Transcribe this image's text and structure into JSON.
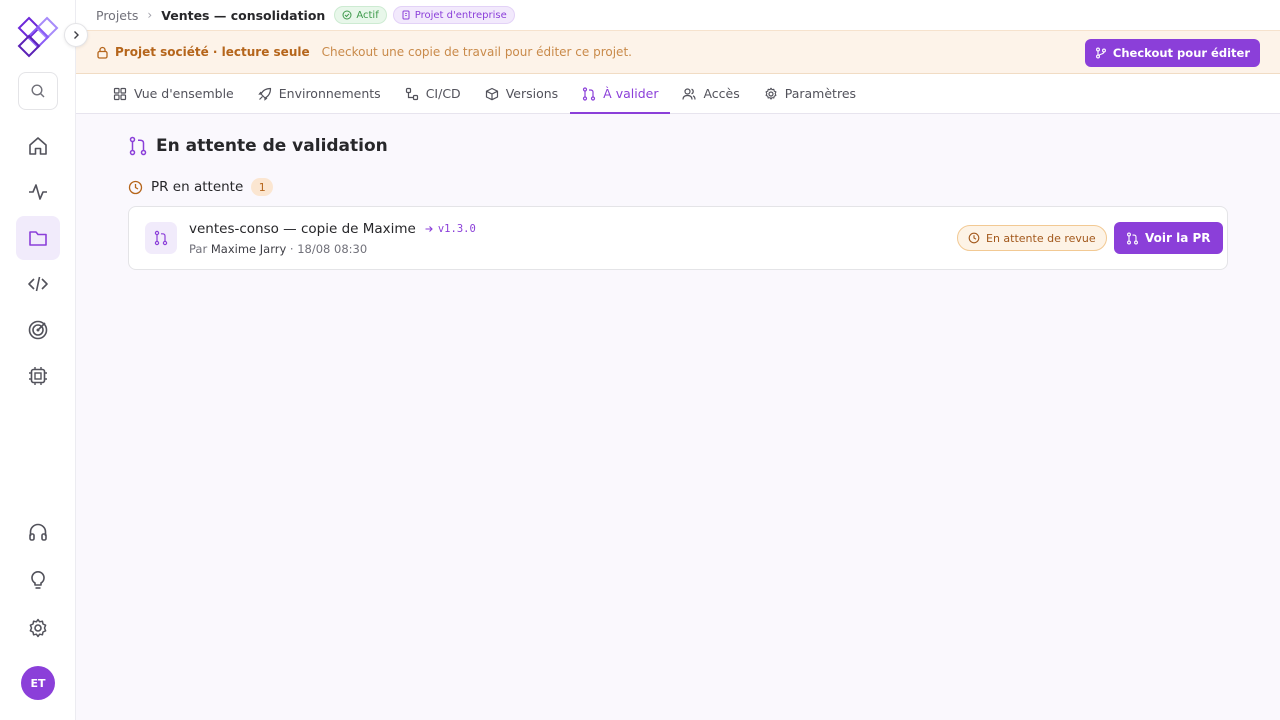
{
  "colors": {
    "accent": "#8b3fd9",
    "warning": "#b5651b",
    "success": "#3f9a4c"
  },
  "sidebar": {
    "search_icon": "search-icon",
    "items": [
      {
        "name": "home",
        "icon": "home-icon",
        "active": false
      },
      {
        "name": "activity",
        "icon": "activity-icon",
        "active": false
      },
      {
        "name": "projects",
        "icon": "folder-icon",
        "active": true
      },
      {
        "name": "code",
        "icon": "code-icon",
        "active": false
      },
      {
        "name": "target",
        "icon": "target-icon",
        "active": false
      },
      {
        "name": "chip",
        "icon": "chip-icon",
        "active": false
      }
    ],
    "bottom": [
      {
        "name": "support",
        "icon": "headphones-icon"
      },
      {
        "name": "ideas",
        "icon": "lightbulb-icon"
      },
      {
        "name": "settings",
        "icon": "gear-icon"
      }
    ],
    "avatar_initials": "ET"
  },
  "breadcrumb": {
    "root": "Projets",
    "current": "Ventes — consolidation",
    "status_badge": "Actif",
    "type_badge": "Projet d'entreprise"
  },
  "banner": {
    "title": "Projet société · lecture seule",
    "message": "Checkout une copie de travail pour éditer ce projet.",
    "button": "Checkout pour éditer"
  },
  "tabs": [
    {
      "label": "Vue d'ensemble",
      "icon": "grid-icon",
      "active": false
    },
    {
      "label": "Environnements",
      "icon": "rocket-icon",
      "active": false
    },
    {
      "label": "CI/CD",
      "icon": "pipeline-icon",
      "active": false
    },
    {
      "label": "Versions",
      "icon": "box-icon",
      "active": false
    },
    {
      "label": "À valider",
      "icon": "git-pull-request-icon",
      "active": true
    },
    {
      "label": "Accès",
      "icon": "users-icon",
      "active": false
    },
    {
      "label": "Paramètres",
      "icon": "gear-icon",
      "active": false
    }
  ],
  "main": {
    "title": "En attente de validation",
    "pending": {
      "label": "PR en attente",
      "count": "1",
      "items": [
        {
          "title": "ventes-conso — copie de Maxime",
          "version": "v1.3.0",
          "by_label": "Par",
          "author": "Maxime Jarry",
          "date": "· 18/08 08:30",
          "status": "En attente de revue",
          "action": "Voir la PR"
        }
      ]
    }
  }
}
